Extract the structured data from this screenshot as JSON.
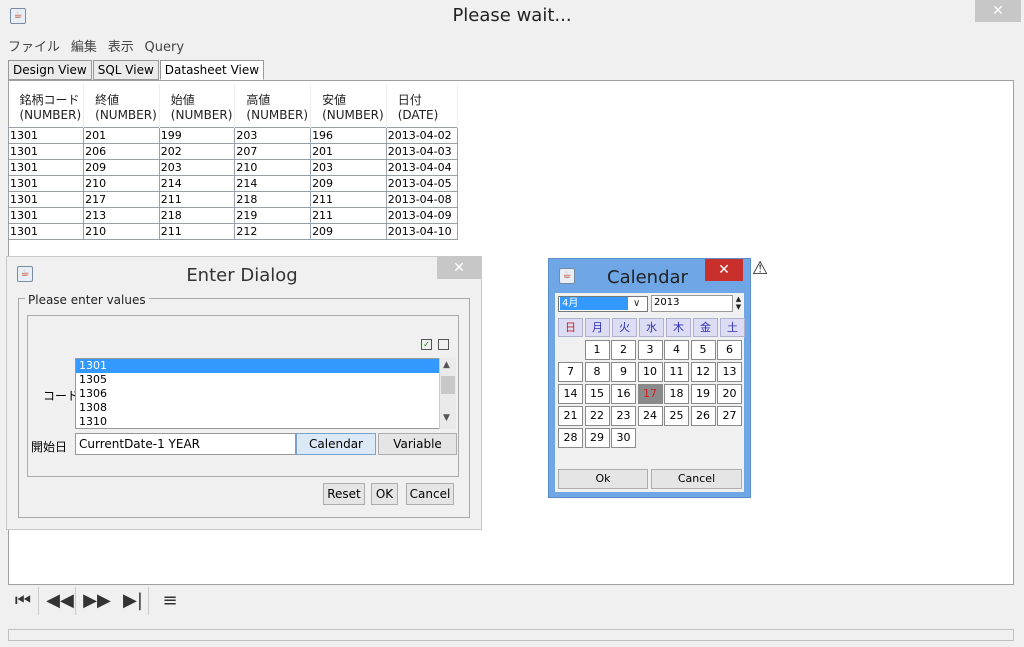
{
  "window": {
    "title": "Please wait...",
    "close": "✕"
  },
  "menu": [
    "ファイル",
    "編集",
    "表示",
    "Query"
  ],
  "tabs": [
    {
      "label": "Design View",
      "active": false
    },
    {
      "label": "SQL View",
      "active": false
    },
    {
      "label": "Datasheet View",
      "active": true
    }
  ],
  "table": {
    "columns": [
      {
        "name": "銘柄コード",
        "type": "(NUMBER)"
      },
      {
        "name": "終値",
        "type": "(NUMBER)"
      },
      {
        "name": "始値",
        "type": "(NUMBER)"
      },
      {
        "name": "高値",
        "type": "(NUMBER)"
      },
      {
        "name": "安値",
        "type": "(NUMBER)"
      },
      {
        "name": "日付",
        "type": "(DATE)"
      }
    ],
    "rows": [
      [
        "1301",
        "201",
        "199",
        "203",
        "196",
        "2013-04-02"
      ],
      [
        "1301",
        "206",
        "202",
        "207",
        "201",
        "2013-04-03"
      ],
      [
        "1301",
        "209",
        "203",
        "210",
        "203",
        "2013-04-04"
      ],
      [
        "1301",
        "210",
        "214",
        "214",
        "209",
        "2013-04-05"
      ],
      [
        "1301",
        "217",
        "211",
        "218",
        "211",
        "2013-04-08"
      ],
      [
        "1301",
        "213",
        "218",
        "219",
        "211",
        "2013-04-09"
      ],
      [
        "1301",
        "210",
        "211",
        "212",
        "209",
        "2013-04-10"
      ]
    ]
  },
  "enter_dialog": {
    "title": "Enter Dialog",
    "close": "✕",
    "legend": "Please enter values",
    "code_label": "コード",
    "code_options": [
      "1301",
      "1305",
      "1306",
      "1308",
      "1310"
    ],
    "selected_code": "1301",
    "date_label": "開始日",
    "date_value": "CurrentDate-1 YEAR",
    "calendar_btn": "Calendar",
    "variable_btn": "Variable",
    "reset_btn": "Reset",
    "ok_btn": "OK",
    "cancel_btn": "Cancel"
  },
  "calendar": {
    "title": "Calendar",
    "close": "✕",
    "month": "4月",
    "year": "2013",
    "weekdays": [
      "日",
      "月",
      "火",
      "水",
      "木",
      "金",
      "土"
    ],
    "first_weekday_index": 1,
    "days": [
      "1",
      "2",
      "3",
      "4",
      "5",
      "6",
      "7",
      "8",
      "9",
      "10",
      "11",
      "12",
      "13",
      "14",
      "15",
      "16",
      "17",
      "18",
      "19",
      "20",
      "21",
      "22",
      "23",
      "24",
      "25",
      "26",
      "27",
      "28",
      "29",
      "30"
    ],
    "today": "17",
    "ok": "Ok",
    "cancel": "Cancel"
  },
  "nav": {
    "first": "⏮",
    "prev": "◀◀",
    "next": "▶▶",
    "last": "▶|",
    "report": "≡"
  },
  "colors": {
    "calendar_frame": "#6fa7e6",
    "selection": "#3399ff",
    "close_red": "#c9302c"
  }
}
